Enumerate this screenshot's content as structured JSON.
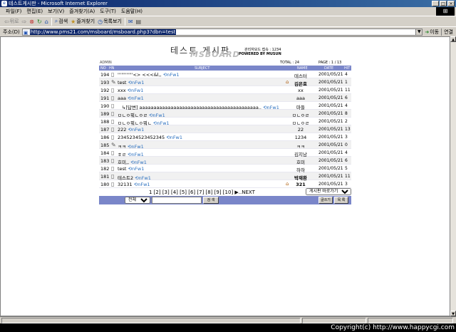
{
  "window": {
    "title": "테스트게시판 - Microsoft Internet Explorer"
  },
  "menu": [
    "파일(F)",
    "편집(E)",
    "보기(V)",
    "즐겨찾기(A)",
    "도구(T)",
    "도움말(H)"
  ],
  "toolbar": {
    "back": "뒤로",
    "search": "검색",
    "favorites": "즐겨찾기",
    "history": "목록보기"
  },
  "address": {
    "label": "주소(D)",
    "url": "http://www.pms21.com/msboard/msboard.php3?dbn=test",
    "go": "이동",
    "links": "연결"
  },
  "board": {
    "title": "테스트 게시판",
    "logo": "MSBOARD",
    "admin_info": "관리자모드 접속 : 1234",
    "powered": "POWERED BY MUSUN",
    "admin_link": "ADMIN",
    "total": "TOTAL : 24",
    "page": "PAGE : 1 / 13",
    "columns": {
      "no": "NO",
      "hn": "HN",
      "subject": "SUBJECT",
      "name": "NAME",
      "date": "DATE",
      "hit": "HIT"
    },
    "rows": [
      {
        "no": "194",
        "subject": "''''''''''''<> <<<&l,,",
        "reply": "nFw1",
        "name": "데스터",
        "date": "2001/05/21",
        "hit": "4"
      },
      {
        "no": "193",
        "subject": "test",
        "reply": "nFw1",
        "name": "김은효",
        "date": "2001/05/21",
        "hit": "1",
        "bold": true,
        "home": true,
        "pencil": true
      },
      {
        "no": "192",
        "subject": "xxx",
        "reply": "nFw1",
        "name": "xx",
        "date": "2001/05/21",
        "hit": "11"
      },
      {
        "no": "191",
        "subject": "aaa",
        "reply": "nFw1",
        "name": "aaa",
        "date": "2001/05/21",
        "hit": "6"
      },
      {
        "no": "190",
        "subject": "[답변] aaaaaaaaaaaaaaaaaaaaaaaaaaaaaaaaaaaaaaaaaa..",
        "reply": "nFw1",
        "name": "마들",
        "date": "2001/05/21",
        "hit": "4",
        "indent": true
      },
      {
        "no": "189",
        "subject": "ㅁㄴㅇ뭐ㄴㅇㄹ",
        "reply": "nFw1",
        "name": "ㅁㄴㅇㄹ",
        "date": "2001/05/21",
        "hit": "8"
      },
      {
        "no": "188",
        "subject": "ㅁㄴㅇ뭐ㄴㅇ뭐ㄴ",
        "reply": "nFw1",
        "name": "ㅁㄴㅇㄹ",
        "date": "2001/05/21",
        "hit": "2"
      },
      {
        "no": "187",
        "subject": "222",
        "reply": "nFw1",
        "name": "22",
        "date": "2001/05/21",
        "hit": "13"
      },
      {
        "no": "186",
        "subject": "2345234523452345",
        "reply": "nFw1",
        "name": "1234",
        "date": "2001/05/21",
        "hit": "3"
      },
      {
        "no": "185",
        "subject": "ㅋㅋ",
        "reply": "nFw1",
        "name": "ㅋㅋ",
        "date": "2001/05/21",
        "hit": "0",
        "pencil": true
      },
      {
        "no": "184",
        "subject": "ㅎㄹ",
        "reply": "nFw1",
        "name": "김지남",
        "date": "2001/05/21",
        "hit": "4"
      },
      {
        "no": "183",
        "subject": "호미,,",
        "reply": "nFw1",
        "name": "호미",
        "date": "2001/05/21",
        "hit": "6"
      },
      {
        "no": "182",
        "subject": "test",
        "reply": "nFw1",
        "name": "하하",
        "date": "2001/05/21",
        "hit": "5"
      },
      {
        "no": "181",
        "subject": "테스트2",
        "reply": "nFw1",
        "name": "박재환",
        "date": "2001/05/21",
        "hit": "11",
        "bold": true
      },
      {
        "no": "180",
        "subject": "32131",
        "reply": "nFw1",
        "name": "321",
        "date": "2001/05/21",
        "hit": "3",
        "bold": true,
        "home": true
      }
    ],
    "pager": "1 [2] [3] [4] [5] [6] [7] [8] [9] [10] ▶..NEXT",
    "jump_label": "게시판 바로가기",
    "search_scope": "전체",
    "search_button": "검 색",
    "write_button": "글쓰기",
    "list_button": "목 록"
  },
  "footer": {
    "copyright": "Copyright(c) http://www.happycgi.com"
  }
}
